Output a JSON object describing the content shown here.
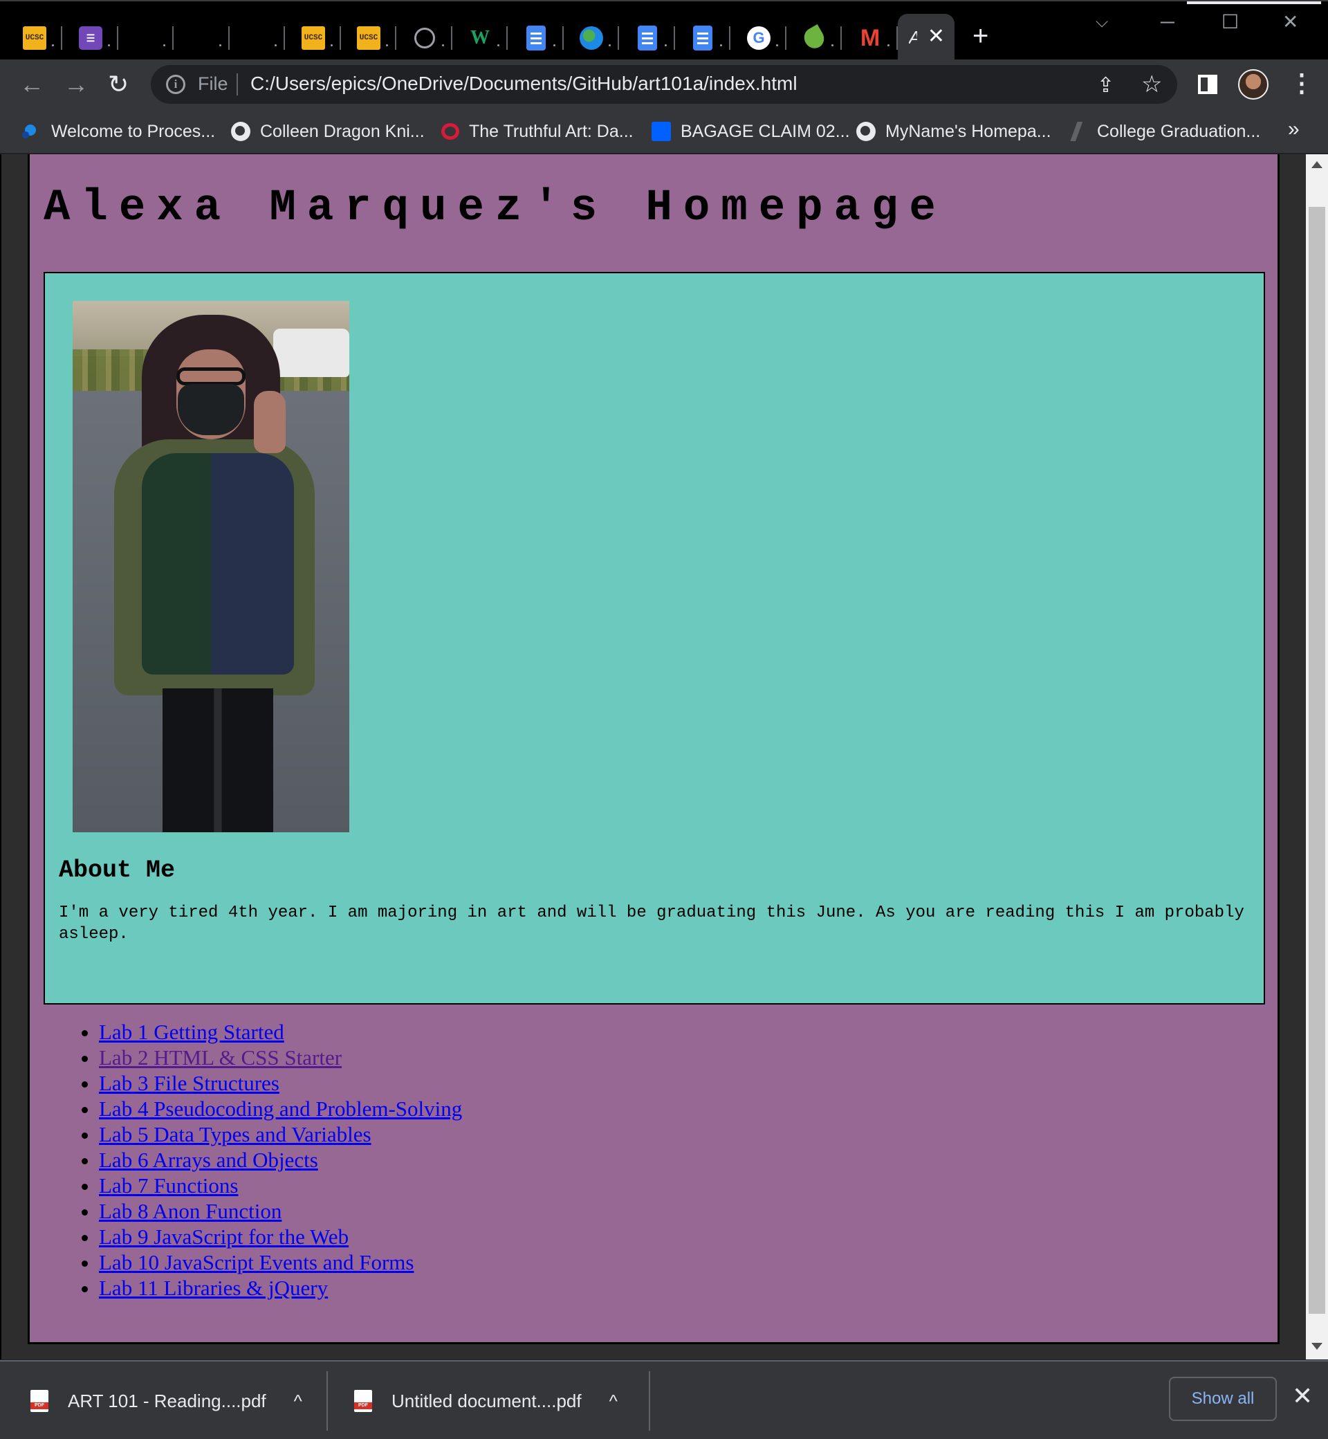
{
  "browser": {
    "tabs": [
      {
        "favicon": "ucsc-icon",
        "kind": "ucsc"
      },
      {
        "favicon": "list-icon",
        "kind": "purple"
      },
      {
        "favicon": "blank-icon",
        "kind": "blank"
      },
      {
        "favicon": "blank-icon",
        "kind": "blank"
      },
      {
        "favicon": "blank-icon",
        "kind": "blank"
      },
      {
        "favicon": "ucsc-icon",
        "kind": "ucsc"
      },
      {
        "favicon": "ucsc-icon",
        "kind": "ucsc"
      },
      {
        "favicon": "github-icon",
        "kind": "gh"
      },
      {
        "favicon": "webtoon-icon",
        "kind": "w"
      },
      {
        "favicon": "docs-icon",
        "kind": "docs"
      },
      {
        "favicon": "globe-icon",
        "kind": "globe"
      },
      {
        "favicon": "docs-icon",
        "kind": "docs"
      },
      {
        "favicon": "docs-icon",
        "kind": "docs"
      },
      {
        "favicon": "google-icon",
        "kind": "google"
      },
      {
        "favicon": "evernote-icon",
        "kind": "evernote"
      },
      {
        "favicon": "gmail-icon",
        "kind": "gmail"
      }
    ],
    "active_tab": {
      "title": "A",
      "close": "✕"
    },
    "new_tab": "+",
    "window": {
      "minimize": "─",
      "maximize": "☐",
      "close": "✕",
      "tab_search": "⌵"
    },
    "nav": {
      "back": "←",
      "forward": "→",
      "reload": "↻"
    },
    "omnibox": {
      "info": "i",
      "scheme": "File",
      "url": "C:/Users/epics/OneDrive/Documents/GitHub/art101a/index.html"
    },
    "actions": {
      "share": "⇪",
      "star": "☆",
      "menu": "⋮"
    },
    "bookmarks": [
      {
        "label": "Welcome to Proces...",
        "icon": "processing-icon"
      },
      {
        "label": "Colleen Dragon Kni...",
        "icon": "globe-icon"
      },
      {
        "label": "The Truthful Art: Da...",
        "icon": "opera-icon"
      },
      {
        "label": "BAGAGE CLAIM 02...",
        "icon": "dropbox-icon"
      },
      {
        "label": "MyName's Homepa...",
        "icon": "globe-icon"
      },
      {
        "label": "College Graduation...",
        "icon": "slash-icon"
      }
    ],
    "bookmarks_more": "»"
  },
  "page": {
    "title": "Alexa Marquez's Homepage",
    "about_heading": "About Me",
    "about_text": "I'm a very tired 4th year. I am majoring in art and will be graduating this June. As you are reading this I am probably asleep.",
    "labs": [
      {
        "label": "Lab 1 Getting Started",
        "visited": false
      },
      {
        "label": "Lab 2 HTML & CSS Starter",
        "visited": true
      },
      {
        "label": "Lab 3 File Structures",
        "visited": false
      },
      {
        "label": "Lab 4 Pseudocoding and Problem-Solving",
        "visited": false
      },
      {
        "label": "Lab 5 Data Types and Variables",
        "visited": false
      },
      {
        "label": "Lab 6 Arrays and Objects",
        "visited": false
      },
      {
        "label": "Lab 7 Functions",
        "visited": false
      },
      {
        "label": "Lab 8 Anon Function",
        "visited": false
      },
      {
        "label": "Lab 9 JavaScript for the Web",
        "visited": false
      },
      {
        "label": "Lab 10 JavaScript Events and Forms",
        "visited": false
      },
      {
        "label": "Lab 11 Libraries & jQuery",
        "visited": false
      }
    ],
    "colors": {
      "page_bg": "#966893",
      "card_bg": "#6bc9be",
      "link": "#0000ee",
      "visited_link": "#551a8b"
    }
  },
  "downloads": {
    "items": [
      {
        "name": "ART 101 - Reading....pdf",
        "caret": "^"
      },
      {
        "name": "Untitled document....pdf",
        "caret": "^"
      }
    ],
    "show_all": "Show all",
    "close": "✕"
  }
}
